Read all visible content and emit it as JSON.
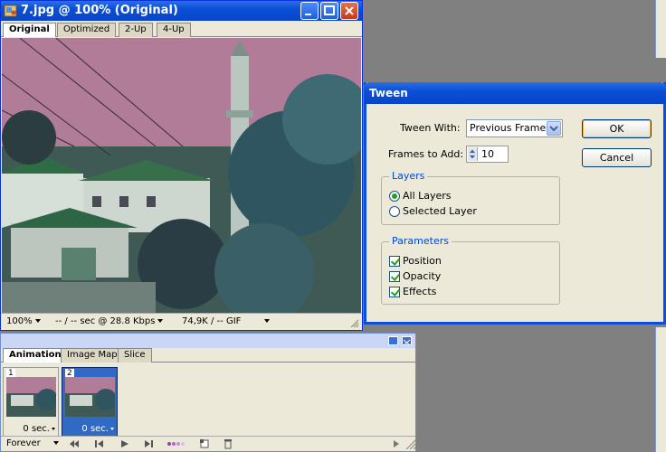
{
  "document_window": {
    "title": "7.jpg @ 100% (Original)",
    "tabs": [
      "Original",
      "Optimized",
      "2-Up",
      "4-Up"
    ],
    "active_tab": "Original",
    "status": {
      "zoom": "100%",
      "download_time": "-- / -- sec @ 28.8 Kbps",
      "file_size": "74,9K / -- GIF"
    }
  },
  "animation_panel": {
    "tabs": [
      "Animation",
      "Image Map",
      "Slice"
    ],
    "active_tab": "Animation",
    "frames": [
      {
        "number": "1",
        "delay": "0 sec.",
        "selected": false
      },
      {
        "number": "2",
        "delay": "0 sec.",
        "selected": true
      }
    ],
    "loop": "Forever"
  },
  "tween_dialog": {
    "title": "Tween",
    "tween_with_label": "Tween With:",
    "tween_with_value": "Previous Frame",
    "frames_to_add_label": "Frames to Add:",
    "frames_to_add_value": "10",
    "layers_group": "Layers",
    "layers_options": [
      "All Layers",
      "Selected Layer"
    ],
    "layers_selected": "All Layers",
    "parameters_group": "Parameters",
    "parameters": [
      "Position",
      "Opacity",
      "Effects"
    ],
    "ok_label": "OK",
    "cancel_label": "Cancel"
  },
  "colors": {
    "xp_titlebar": "#0a4fd6",
    "dialog_face": "#ece9d8",
    "selection": "#316ac5"
  }
}
